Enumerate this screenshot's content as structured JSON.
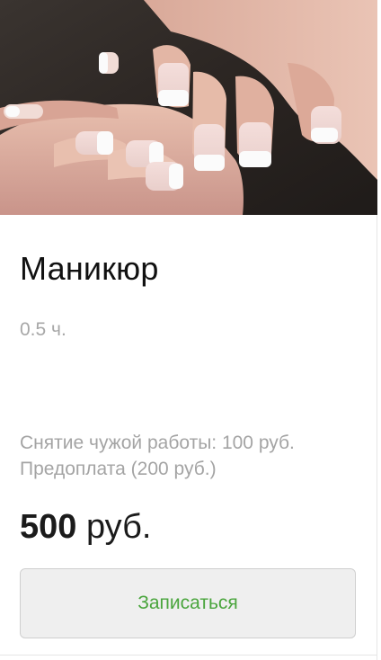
{
  "service": {
    "title": "Маникюр",
    "duration": "0.5 ч.",
    "notes": [
      "Снятие чужой работы: 100 руб.",
      "Предоплата (200 руб.)"
    ],
    "price": {
      "amount": "500",
      "currency": "руб."
    },
    "book_button_label": "Записаться"
  },
  "colors": {
    "button_text": "#4aa53d",
    "button_bg": "#efefef",
    "muted_text": "#a4a4a4"
  }
}
